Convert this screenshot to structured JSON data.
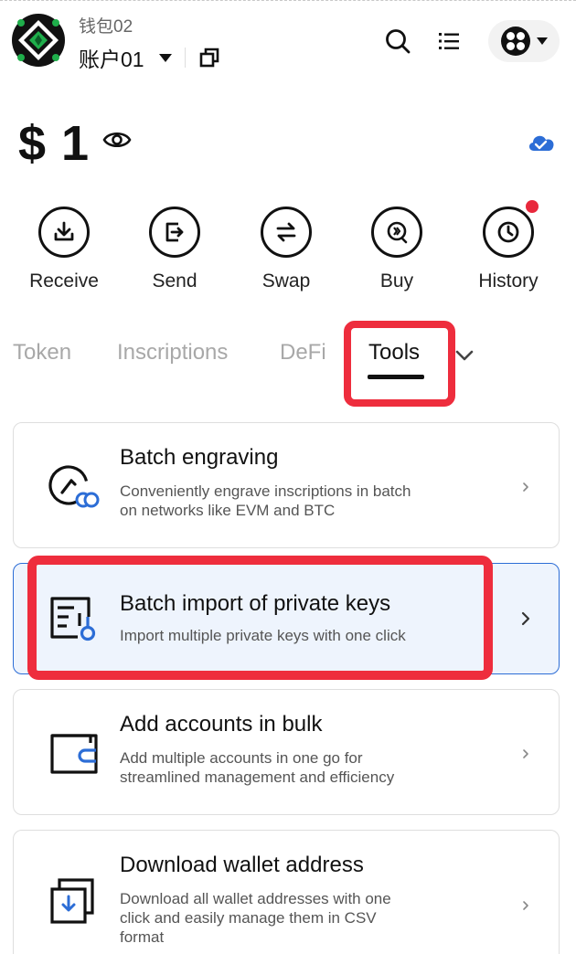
{
  "header": {
    "wallet_name": "钱包02",
    "account_name": "账户01"
  },
  "balance": {
    "amount": "$ 1"
  },
  "actions": [
    {
      "label": "Receive",
      "icon": "download-icon"
    },
    {
      "label": "Send",
      "icon": "send-icon"
    },
    {
      "label": "Swap",
      "icon": "swap-icon"
    },
    {
      "label": "Buy",
      "icon": "buy-icon"
    },
    {
      "label": "History",
      "icon": "clock-icon",
      "has_notification": true
    }
  ],
  "tabs": [
    {
      "label": "Token",
      "active": false
    },
    {
      "label": "Inscriptions",
      "active": false
    },
    {
      "label": "DeFi",
      "active": false
    },
    {
      "label": "Tools",
      "active": true
    }
  ],
  "tools": [
    {
      "title": "Batch engraving",
      "desc_lines": [
        "Conveniently engrave inscriptions in batch",
        "on networks like EVM and BTC"
      ],
      "icon": "engrave-icon"
    },
    {
      "title": "Batch import of private keys",
      "desc_lines": [
        "Import multiple private keys with one click"
      ],
      "icon": "import-keys-icon",
      "selected": true
    },
    {
      "title": "Add accounts in bulk",
      "desc_lines": [
        "Add multiple accounts in one go for",
        "streamlined management and efficiency"
      ],
      "icon": "wallet-icon"
    },
    {
      "title": "Download wallet address",
      "desc_lines": [
        "Download all wallet addresses with one",
        "click and easily manage them in CSV",
        "format"
      ],
      "icon": "download-address-icon"
    }
  ],
  "colors": {
    "highlight": "#ee2d3d",
    "selected_border": "#2c6dd6",
    "selected_bg": "#eef4fd",
    "cloud": "#2c6dd6",
    "notification": "#e8283c"
  }
}
